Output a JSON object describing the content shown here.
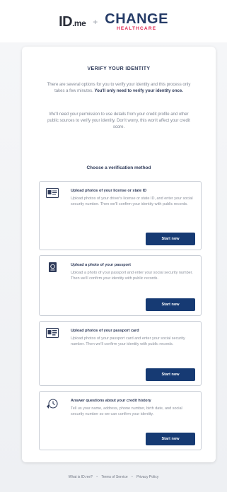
{
  "header": {
    "idme_logo": "ID",
    "idme_suffix": ".me",
    "plus": "+",
    "change_logo": "CHANGE",
    "change_sub": "HEALTHCARE"
  },
  "card": {
    "title": "VERIFY YOUR IDENTITY",
    "intro_text": "There are several options for you to verify your identity and this process only takes a few minutes.",
    "intro_bold": "You'll only need to verify your identity once.",
    "intro2_text": "We'll need your permission to use details from your credit profile and other public sources to verify your identity. Don't worry, this won't affect your credit score.",
    "section_heading": "Choose a verification method"
  },
  "options": [
    {
      "icon": "license-icon",
      "title": "Upload photos of your license or state ID",
      "description": "Upload photos of your driver's license or state ID, and enter your social security number. Then we'll confirm your identity with public records.",
      "button": "Start now"
    },
    {
      "icon": "passport-icon",
      "title": "Upload a photo of your passport",
      "description": "Upload a photo of your passport and enter your social security number. Then we'll confirm your identity with public records.",
      "button": "Start now"
    },
    {
      "icon": "passport-card-icon",
      "title": "Upload photos of your passport card",
      "description": "Upload photos of your passport card and enter your social security number. Then we'll confirm your identity with public records.",
      "button": "Start now"
    },
    {
      "icon": "credit-history-icon",
      "title": "Answer questions about your credit history",
      "description": "Tell us your name, address, phone number, birth date, and social security number so we can confirm your identity.",
      "button": "Start now"
    }
  ],
  "footer": {
    "link1": "What is ID.me?",
    "sep": "•",
    "link2": "Terms of Service",
    "link3": "Privacy Policy"
  },
  "colors": {
    "button_bg": "#163a73",
    "change_red": "#e0234e",
    "change_navy": "#253b67"
  }
}
